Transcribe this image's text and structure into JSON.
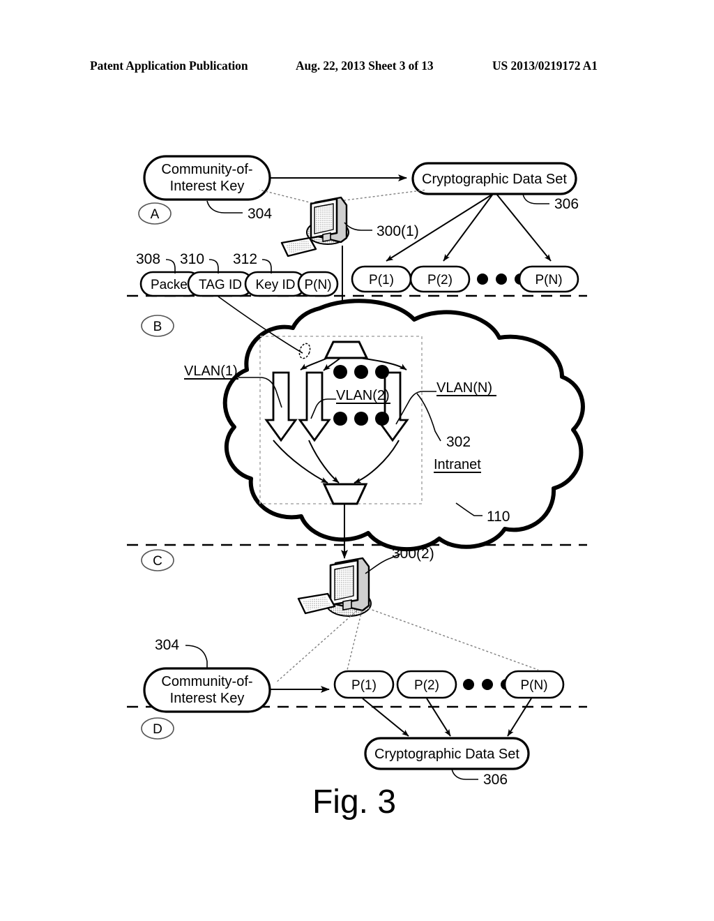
{
  "header": {
    "left": "Patent Application Publication",
    "middle": "Aug. 22, 2013  Sheet 3 of 13",
    "right": "US 2013/0219172 A1"
  },
  "figure": {
    "caption": "Fig. 3",
    "sections": [
      {
        "id": "A",
        "label": "A"
      },
      {
        "id": "B",
        "label": "B"
      },
      {
        "id": "C",
        "label": "C"
      },
      {
        "id": "D",
        "label": "D"
      }
    ],
    "section_a": {
      "coi_key": "Community-of-\nInterest Key",
      "coi_key_line1": "Community-of-",
      "coi_key_line2": "Interest Key",
      "coi_key_ref": "304",
      "crypto_data_set": "Cryptographic Data Set",
      "crypto_data_set_ref": "306",
      "workstation_ref": "300(1)",
      "packet_fields": [
        {
          "label": "Packet",
          "ref": "308"
        },
        {
          "label": "TAG ID",
          "ref": "310"
        },
        {
          "label": "Key ID",
          "ref": "312"
        },
        {
          "label": "P(N)",
          "ref": ""
        }
      ],
      "partitions": [
        "P(1)",
        "P(2)",
        "P(N)"
      ],
      "ellipsis_dots": 3
    },
    "section_b": {
      "network_label": "Intranet",
      "network_ref": "110",
      "vlan_group_ref": "302",
      "vlans": [
        "VLAN(1)",
        "VLAN(2)",
        "VLAN(N)"
      ],
      "vlan_channels": 3,
      "dot_rows": 2,
      "dots_per_row": 3
    },
    "section_c": {
      "workstation_ref": "300(2)",
      "coi_key_line1": "Community-of-",
      "coi_key_line2": "Interest Key",
      "coi_key_ref": "304",
      "partitions": [
        "P(1)",
        "P(2)",
        "P(N)"
      ],
      "ellipsis_dots": 3
    },
    "section_d": {
      "crypto_data_set": "Cryptographic Data Set",
      "crypto_data_set_ref": "306"
    }
  },
  "colors": {
    "ink": "#000000",
    "paper": "#ffffff",
    "dashed_box": "#b4b4b4",
    "dot_leader": "#808080",
    "section_marker": "#555555"
  }
}
